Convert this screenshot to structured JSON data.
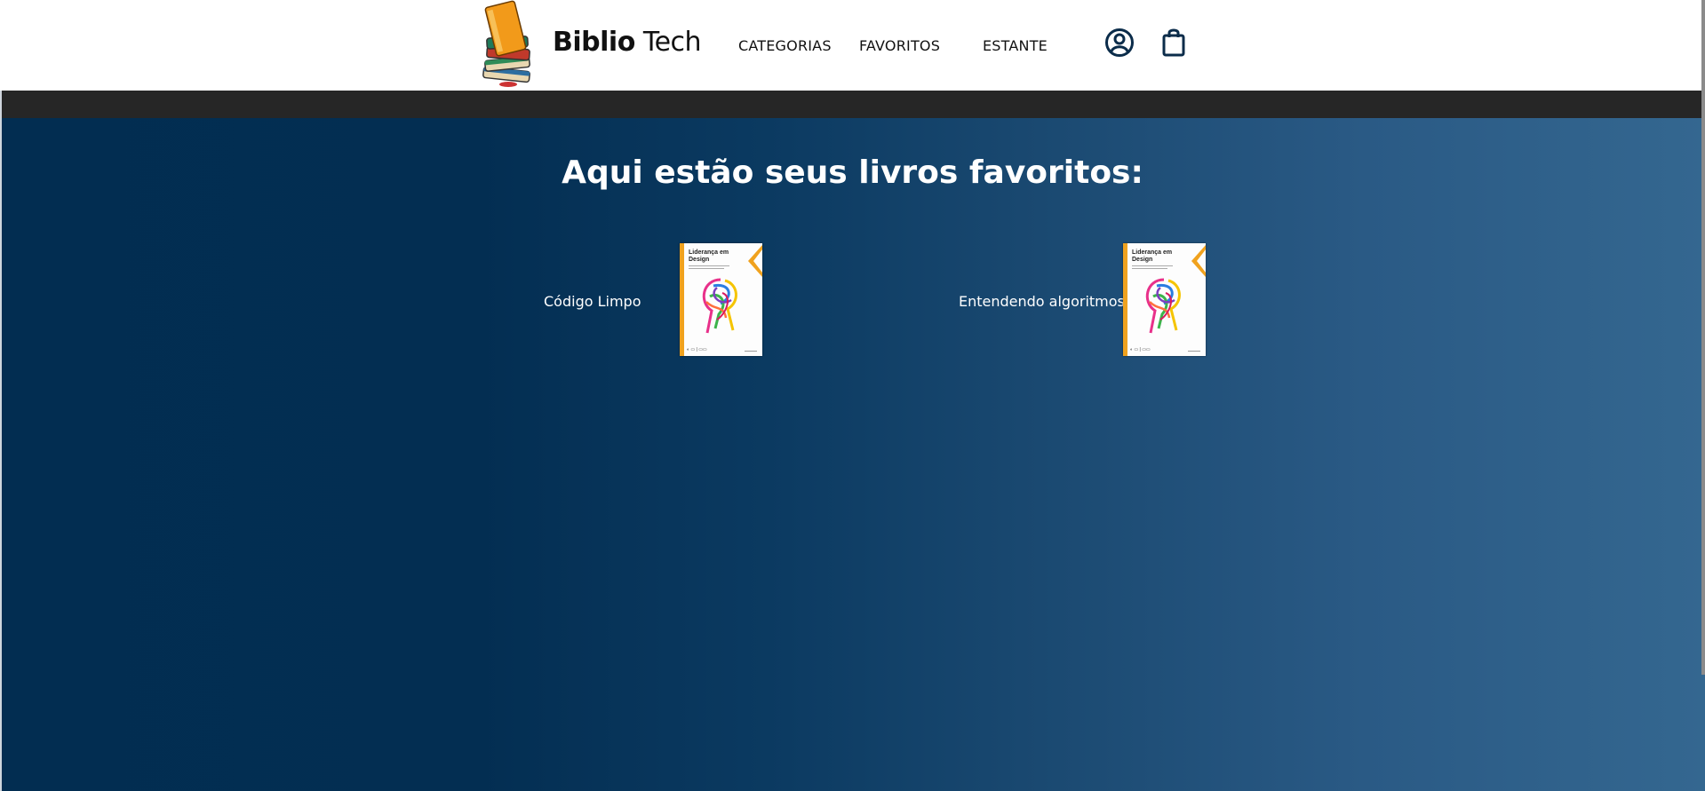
{
  "header": {
    "brand_bold": "Biblio",
    "brand_rest": " Tech",
    "nav": {
      "categorias": "CATEGORIAS",
      "favoritos": "FAVORITOS",
      "estante": "ESTANTE"
    },
    "icons": {
      "user": "user-circle-icon",
      "bag": "shopping-bag-icon"
    }
  },
  "main": {
    "heading": "Aqui estão seus livros favoritos:",
    "favorites": [
      {
        "title": "Código Limpo",
        "cover_title": "Liderança em Design"
      },
      {
        "title": "Entendendo algoritmos",
        "cover_title": "Liderança em Design"
      }
    ]
  },
  "colors": {
    "strip": "#262626",
    "gradient_start": "#022d51",
    "gradient_end": "#346790",
    "icon": "#0b2c4a",
    "cover_accent": "#f0a21e"
  }
}
